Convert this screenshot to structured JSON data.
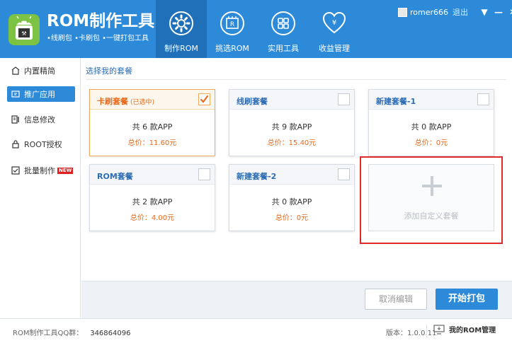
{
  "app": {
    "title": "ROM制作工具",
    "subtitle": "•线刷包 •卡刷包 •一键打包工具"
  },
  "nav": [
    {
      "label": "制作ROM",
      "icon": "gear-icon",
      "active": true
    },
    {
      "label": "挑选ROM",
      "icon": "rom-chip-icon",
      "active": false
    },
    {
      "label": "实用工具",
      "icon": "grid-tools-icon",
      "active": false
    },
    {
      "label": "收益管理",
      "icon": "heart-yen-icon",
      "active": false
    }
  ],
  "user": {
    "name": "romer666",
    "logout": "退出",
    "dropdown": "▼",
    "minimize": "—",
    "close": "✕"
  },
  "sidebar": {
    "items": [
      {
        "label": "内置精简",
        "icon": "builtin-icon",
        "active": false
      },
      {
        "label": "推广应用",
        "icon": "promote-icon",
        "active": true
      },
      {
        "label": "信息修改",
        "icon": "info-edit-icon",
        "active": false
      },
      {
        "label": "ROOT授权",
        "icon": "lock-icon",
        "active": false
      },
      {
        "label": "批量制作",
        "icon": "batch-icon",
        "active": false,
        "badge": "NEW"
      }
    ]
  },
  "main": {
    "title": "选择我的套餐",
    "packages": [
      {
        "name": "卡刷套餐",
        "tag": "(已选中)",
        "count": "共 6 款APP",
        "price": "总价：11.60元",
        "selected": true
      },
      {
        "name": "线刷套餐",
        "tag": "",
        "count": "共 9 款APP",
        "price": "总价：15.40元",
        "selected": false
      },
      {
        "name": "新建套餐-1",
        "tag": "",
        "count": "共 0 款APP",
        "price": "总价：0元",
        "selected": false
      },
      {
        "name": "ROM套餐",
        "tag": "",
        "count": "共 2 款APP",
        "price": "总价：4.00元",
        "selected": false
      },
      {
        "name": "新建套餐-2",
        "tag": "",
        "count": "共 0 款APP",
        "price": "总价：0元",
        "selected": false
      }
    ],
    "add_label": "添加自定义套餐",
    "cancel_label": "取消编辑",
    "start_label": "开始打包"
  },
  "status": {
    "qq_label": "ROM制作工具QQ群：",
    "qq_number": "346864096",
    "version": "版本：1.0.0.11",
    "my_rom": "我的ROM管理"
  },
  "colors": {
    "primary": "#2c8ad8",
    "primary_dark": "#1f70b8",
    "accent": "#e86a1a",
    "highlight": "#e02a2a"
  }
}
